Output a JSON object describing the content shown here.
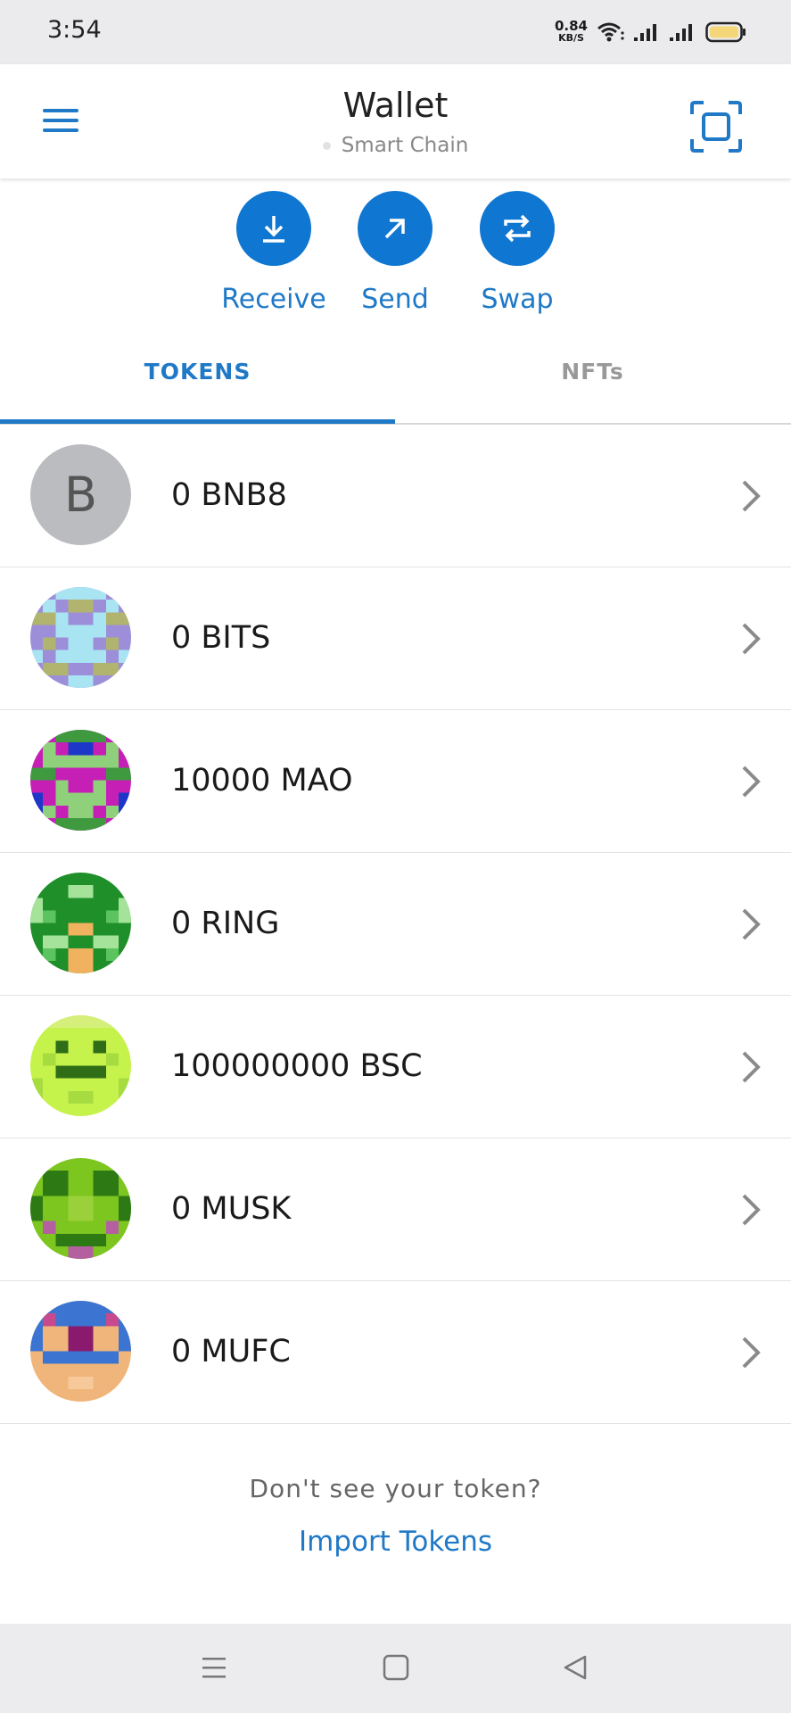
{
  "status_bar": {
    "time": "3:54",
    "net_speed": "0.84",
    "net_unit": "KB/S",
    "icons": [
      "wifi-icon",
      "signal-icon",
      "signal-icon",
      "battery-icon"
    ]
  },
  "header": {
    "title": "Wallet",
    "network": "Smart Chain",
    "menu_icon": "hamburger-menu-icon",
    "scan_icon": "qr-scan-icon"
  },
  "actions": [
    {
      "label": "Receive",
      "icon": "download-arrow-icon"
    },
    {
      "label": "Send",
      "icon": "arrow-up-right-icon"
    },
    {
      "label": "Swap",
      "icon": "swap-arrows-icon"
    }
  ],
  "tabs": [
    {
      "label": "TOKENS",
      "active": true
    },
    {
      "label": "NFTs",
      "active": false
    }
  ],
  "tokens": [
    {
      "text": "0 BNB8",
      "avatar_letter": "B"
    },
    {
      "text": "0 BITS"
    },
    {
      "text": "10000 MAO"
    },
    {
      "text": "0 RING"
    },
    {
      "text": "100000000 BSC"
    },
    {
      "text": "0 MUSK"
    },
    {
      "text": "0 MUFC"
    }
  ],
  "footer": {
    "question": "Don't see your token?",
    "link": "Import Tokens"
  },
  "colors": {
    "accent": "#1f79c7",
    "action_button": "#0f76d1",
    "status_bar_bg": "#ebebee",
    "battery_fill": "#f5d77a"
  },
  "nav_bar": {
    "icons": [
      "recents-icon",
      "home-icon",
      "back-icon"
    ]
  }
}
